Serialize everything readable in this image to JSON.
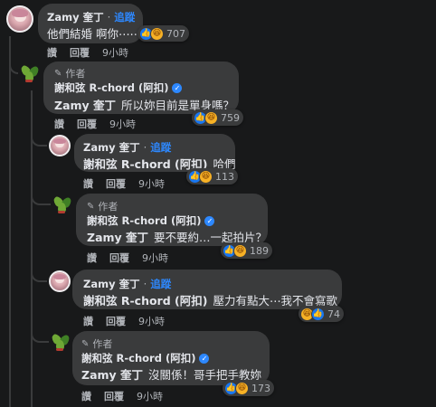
{
  "comments": [
    {
      "id": "c1",
      "author": "Zamy 奎丁",
      "follow": "追蹤",
      "text": "他們結婚 啊你⋯⋯",
      "reactions": [
        "like",
        "haha"
      ],
      "count": "707",
      "actions": [
        "讚",
        "回覆"
      ],
      "time": "9小時"
    },
    {
      "id": "c2",
      "author_badge": "作者",
      "author": "謝和弦 R-chord (阿扣)",
      "tag": "Zamy 奎丁",
      "text": "所以妳目前是單身嗎？",
      "reactions": [
        "like",
        "haha"
      ],
      "count": "759",
      "actions": [
        "讚",
        "回覆"
      ],
      "time": "9小時"
    },
    {
      "id": "c3",
      "author": "Zamy 奎丁",
      "follow": "追蹤",
      "tag": "謝和弦 R-chord (阿扣)",
      "text": "哈們",
      "reactions": [
        "like",
        "haha"
      ],
      "count": "113",
      "actions": [
        "讚",
        "回覆"
      ],
      "time": "9小時"
    },
    {
      "id": "c4",
      "author_badge": "作者",
      "author": "謝和弦 R-chord (阿扣)",
      "tag": "Zamy 奎丁",
      "text": "要不要約…一起拍片？",
      "reactions": [
        "like",
        "haha"
      ],
      "count": "189",
      "actions": [
        "讚",
        "回覆"
      ],
      "time": "9小時"
    },
    {
      "id": "c5",
      "author": "Zamy 奎丁",
      "follow": "追蹤",
      "tag": "謝和弦 R-chord (阿扣)",
      "text": "壓力有點大⋯我不會寫歌",
      "reactions": [
        "haha",
        "like"
      ],
      "count": "74",
      "actions": [
        "讚",
        "回覆"
      ],
      "time": "9小時"
    },
    {
      "id": "c6",
      "author_badge": "作者",
      "author": "謝和弦 R-chord (阿扣)",
      "tag": "Zamy 奎丁",
      "text": "沒關係！哥手把手教妳",
      "reactions": [
        "like",
        "haha"
      ],
      "count": "173",
      "actions": [
        "讚",
        "回覆"
      ],
      "time": "9小時"
    }
  ],
  "icons": {
    "verified": "verified-check-icon",
    "author_badge": "pencil-icon",
    "like": "thumbs-up-icon",
    "haha": "laughing-face-icon"
  },
  "colors": {
    "background": "#18191a",
    "bubble": "#3a3b3c",
    "link": "#2d88ff",
    "like": "#1877f2",
    "haha": "#f7b125"
  }
}
